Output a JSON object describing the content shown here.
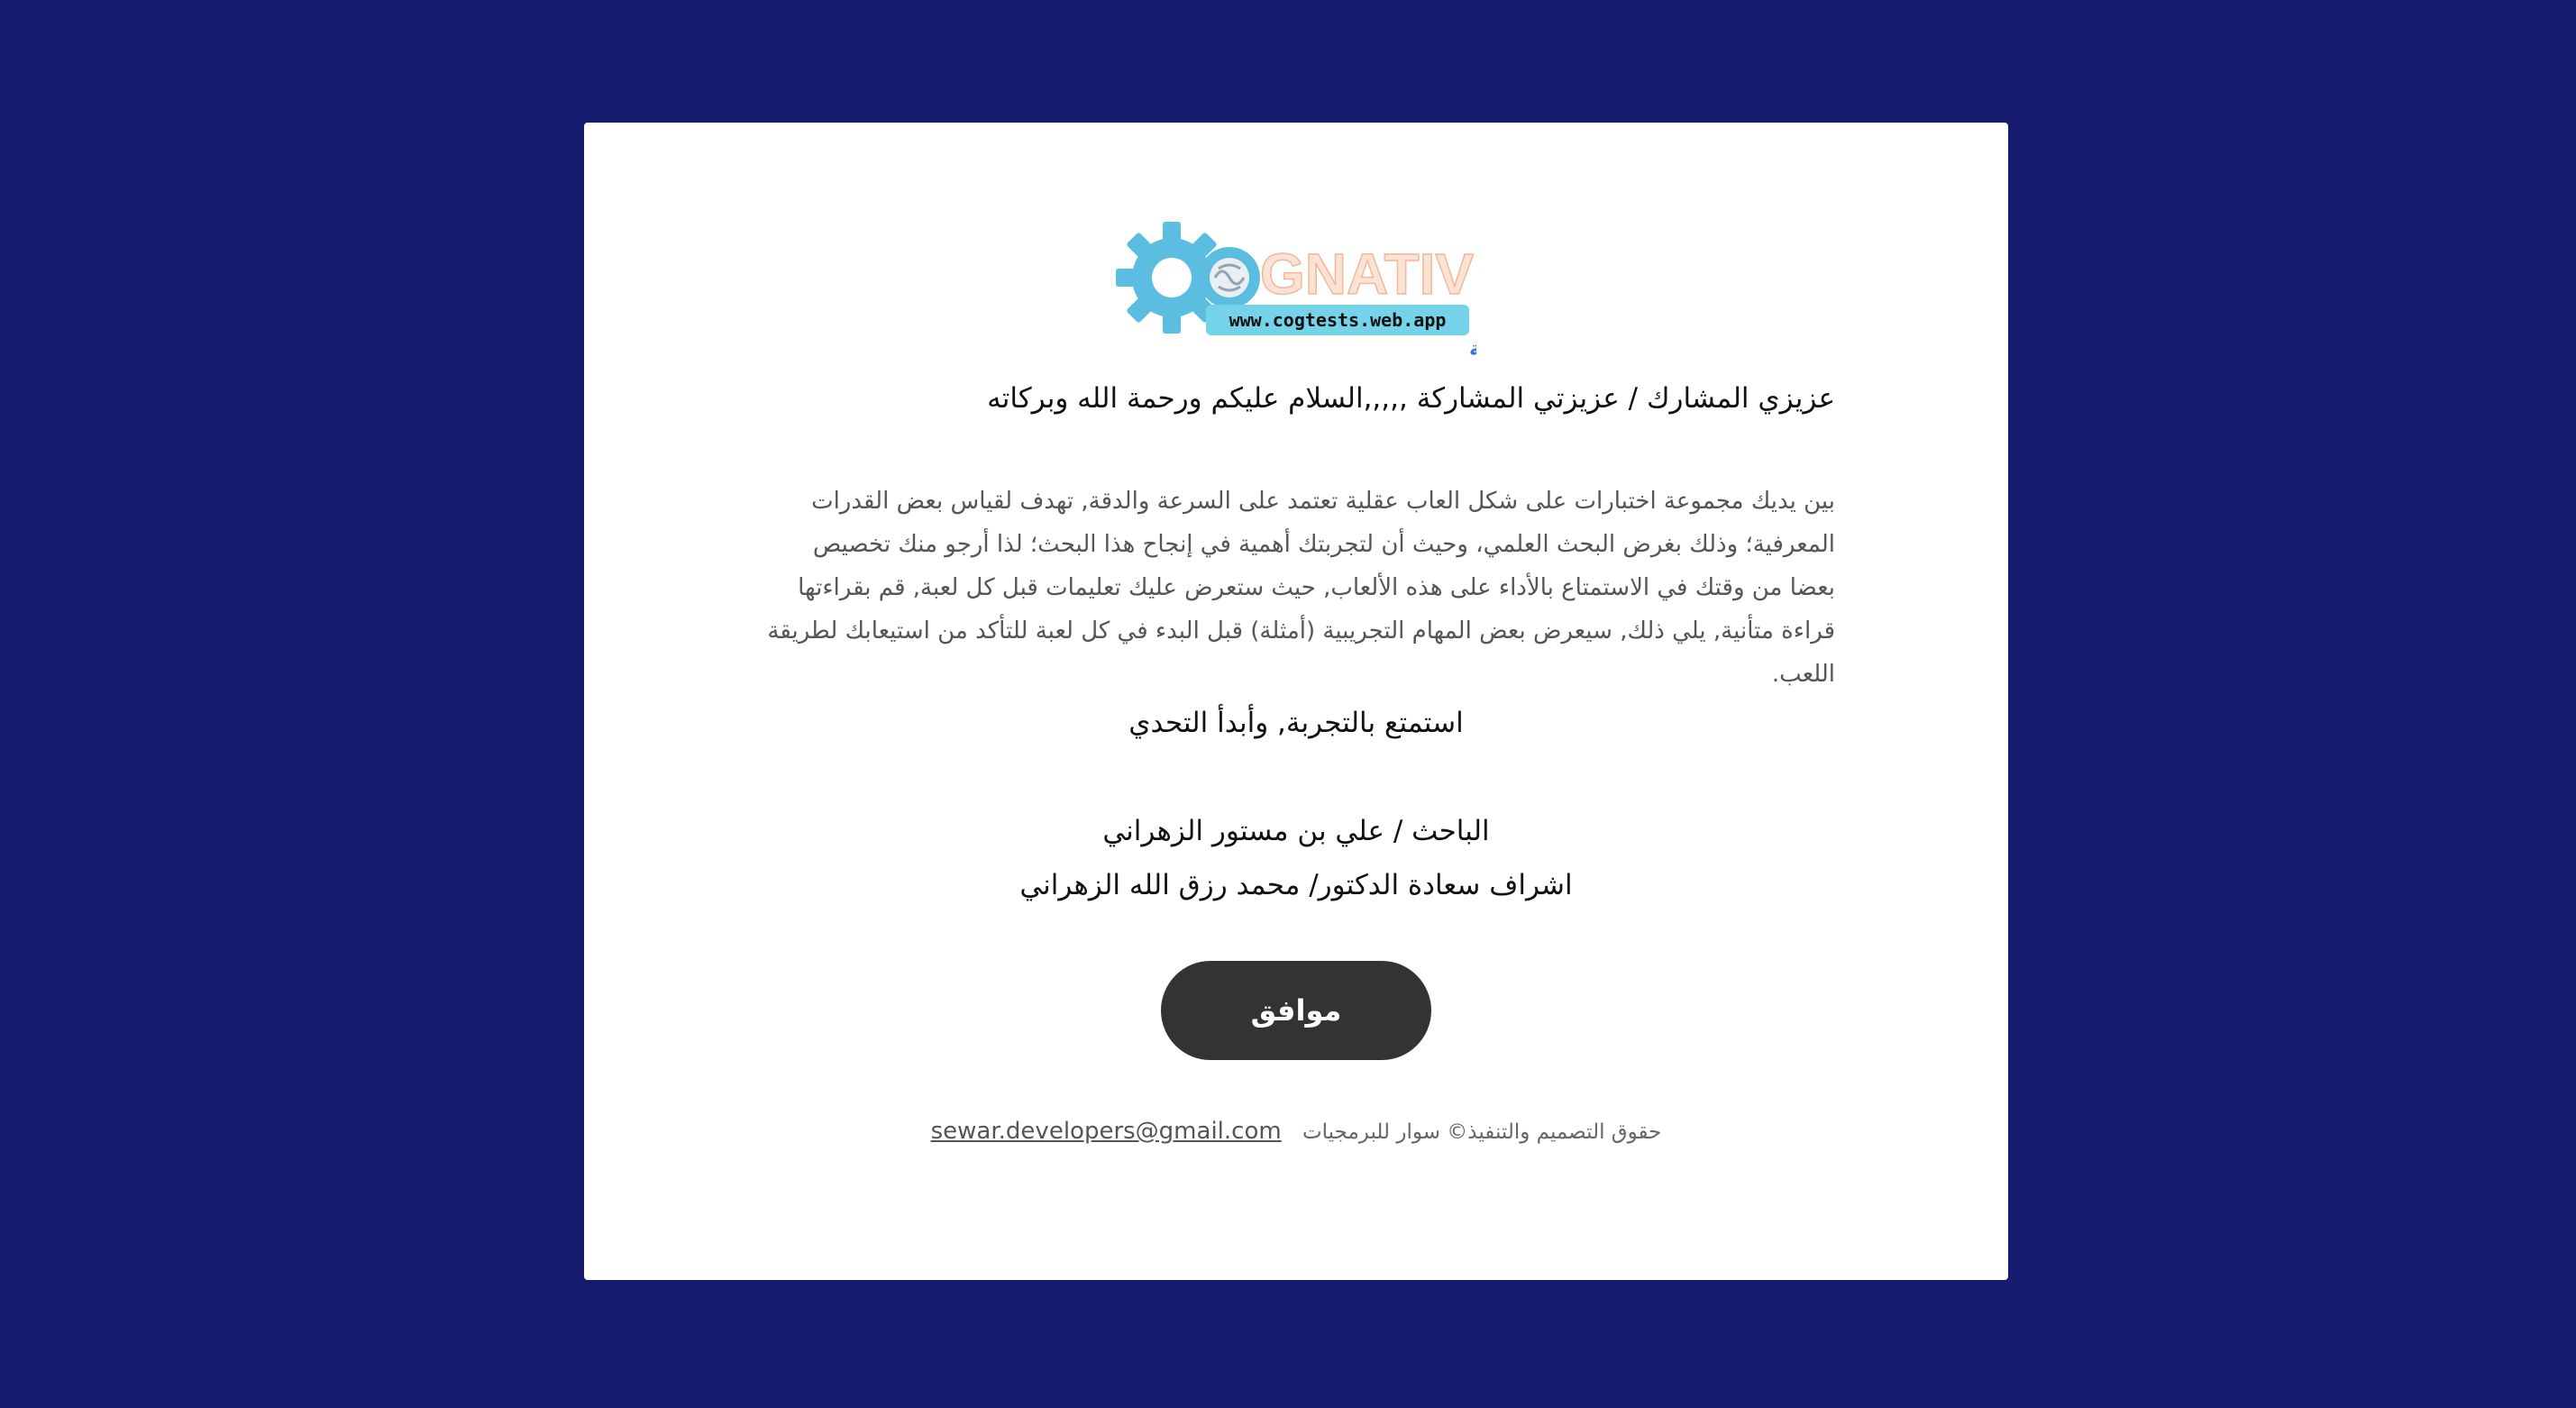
{
  "logo": {
    "brand_letters": "GNATIVE",
    "url_text": "www.cogtests.web.app",
    "arabic_tagline": "منصة الاختبارات المعرفية"
  },
  "greeting": "عزيزي المشارك / عزيزتي المشاركة ,,,,,السلام عليكم ورحمة الله وبركاته",
  "intro": "بين يديك مجموعة اختبارات على شكل العاب عقلية تعتمد على السرعة والدقة, تهدف لقياس بعض القدرات المعرفية؛ وذلك بغرض البحث العلمي، وحيث أن لتجربتك أهمية في إنجاح هذا البحث؛ لذا أرجو منك تخصيص بعضا من وقتك في الاستمتاع بالأداء على هذه الألعاب, حيث ستعرض عليك تعليمات قبل كل لعبة, قم بقراءتها قراءة متأنية, يلي ذلك, سيعرض بعض المهام التجريبية (أمثلة) قبل البدء في كل لعبة للتأكد من استيعابك لطريقة اللعب.",
  "enjoy": "استمتع بالتجربة, وأبدأ التحدي",
  "researcher": "الباحث / علي بن مستور الزهراني",
  "supervisor": "اشراف سعادة الدكتور/ محمد رزق الله الزهراني",
  "agree_button": "موافق",
  "footer": {
    "copyright": "حقوق التصميم والتنفيذ© سوار للبرمجيات",
    "email": "sewar.developers@gmail.com"
  },
  "colors": {
    "background": "#161b6d",
    "card": "#ffffff",
    "button": "#333333",
    "gear": "#5bbde0",
    "tagline": "#3f6fe0"
  }
}
